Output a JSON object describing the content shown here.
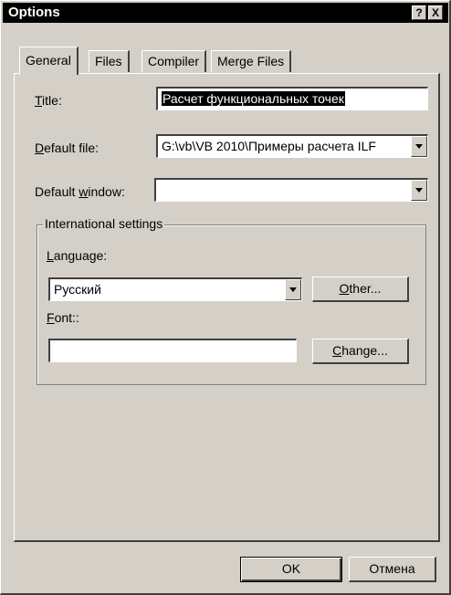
{
  "window": {
    "title": "Options",
    "help_button": "?",
    "close_button": "X"
  },
  "tabs": [
    {
      "label": "General",
      "active": true
    },
    {
      "label": "Files",
      "active": false
    },
    {
      "label": "Compiler",
      "active": false
    },
    {
      "label": "Merge Files",
      "active": false
    }
  ],
  "general": {
    "title_label_hotkey": "T",
    "title_label_rest": "itle:",
    "title_value": "Расчет функциональных точек",
    "default_file_label_hotkey": "D",
    "default_file_label_rest": "efault file:",
    "default_file_value": "G:\\vb\\VB 2010\\Примеры расчета ILF",
    "default_window_label_prefix": "Default ",
    "default_window_label_hotkey": "w",
    "default_window_label_rest": "indow:",
    "default_window_value": ""
  },
  "international": {
    "group_label": "International settings",
    "language_label_hotkey": "L",
    "language_label_rest": "anguage:",
    "language_value": "Русский",
    "other_button_hotkey": "O",
    "other_button_rest": "ther...",
    "font_label_hotkey": "F",
    "font_label_rest": "ont::",
    "font_value": "",
    "change_button_hotkey": "C",
    "change_button_rest": "hange..."
  },
  "footer": {
    "ok_label": "OK",
    "cancel_label": "Отмена"
  },
  "colors": {
    "face": "#d4d0c8",
    "titlebar": "#000000",
    "selection": "#000000"
  }
}
